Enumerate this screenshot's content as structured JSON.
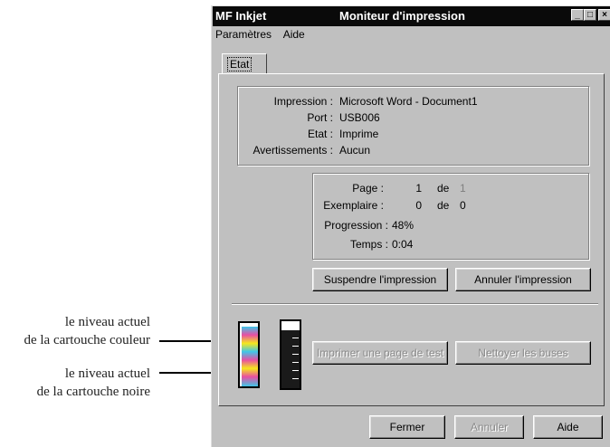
{
  "window": {
    "app_name": "MF Inkjet",
    "title": "Moniteur d'impression"
  },
  "menu": {
    "items": [
      "Paramètres",
      "Aide"
    ]
  },
  "tab": {
    "label": "Etat"
  },
  "info": {
    "rows": [
      {
        "label": "Impression :",
        "value": "Microsoft Word - Document1"
      },
      {
        "label": "Port :",
        "value": "USB006"
      },
      {
        "label": "Etat :",
        "value": "Imprime"
      },
      {
        "label": "Avertissements :",
        "value": "Aucun"
      }
    ]
  },
  "progress": {
    "page_label": "Page :",
    "page_value": "1",
    "page_sep": "de",
    "page_total": "1",
    "copy_label": "Exemplaire :",
    "copy_value": "0",
    "copy_sep": "de",
    "copy_total": "0",
    "progress_label": "Progression :",
    "progress_value": "48%",
    "time_label": "Temps :",
    "time_value": "0:04"
  },
  "buttons": {
    "suspend": "Suspendre l'impression",
    "cancel_print": "Annuler l'impression",
    "print_test": "Imprimer une page de test",
    "clean_nozzles": "Nettoyer les buses",
    "close": "Fermer",
    "cancel": "Annuler",
    "help": "Aide"
  },
  "callouts": {
    "color_cartridge": "le niveau actuel\nde la cartouche couleur",
    "black_cartridge": "le niveau actuel\nde la cartouche noire"
  },
  "colors": {
    "titlebar": "#0a0a0a",
    "face": "#c0c0c0",
    "ink_cyan": "#3fc6e8",
    "ink_magenta": "#e84fa3",
    "ink_yellow": "#f5e81c"
  },
  "icons": [
    "minimize-icon",
    "maximize-icon",
    "close-icon"
  ]
}
